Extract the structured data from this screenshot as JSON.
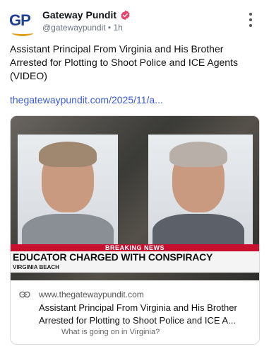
{
  "author": {
    "avatar_text": "GP",
    "name": "Gateway Pundit",
    "handle": "@gatewaypundit",
    "separator": "•",
    "time": "1h"
  },
  "post": {
    "text": "Assistant Principal From Virginia and His Brother Arrested for Plotting to Shoot Police and ICE Agents (VIDEO)",
    "link": "thegatewaypundit.com/2025/11/a..."
  },
  "card": {
    "media": {
      "breaking": "BREAKING NEWS",
      "headline": "EDUCATOR CHARGED WITH CONSPIRACY",
      "location": "VIRGINIA BEACH"
    },
    "domain": "www.thegatewaypundit.com",
    "title": "Assistant Principal From Virginia and His Brother Arrested for Plotting to Shoot Police and ICE A...",
    "description": "What is going on in Virginia?"
  },
  "colors": {
    "link": "#3b5bd9",
    "verified": "#e8436b",
    "breaking_bar": "#c8102e"
  },
  "icons": [
    "verified-badge-icon",
    "more-options-icon",
    "link-icon"
  ]
}
